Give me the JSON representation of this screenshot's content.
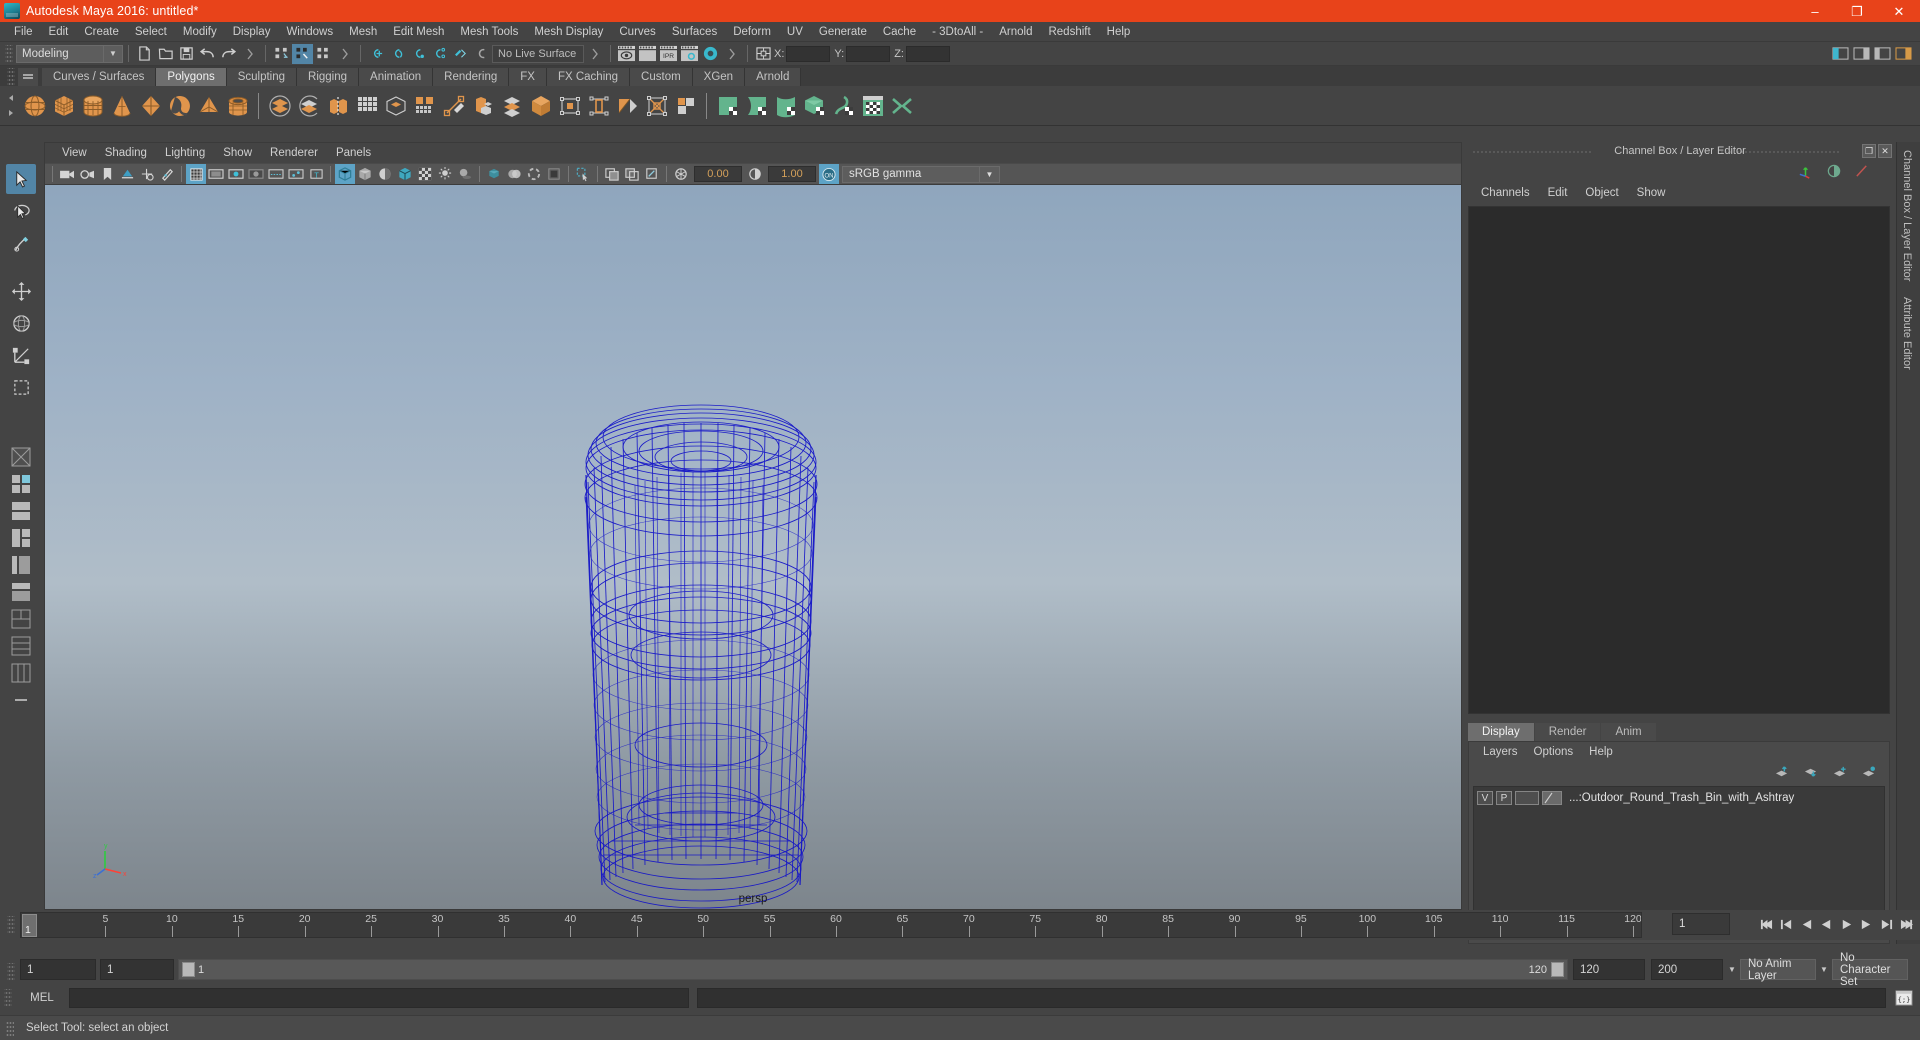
{
  "window": {
    "title": "Autodesk Maya 2016: untitled*",
    "app_icon": "maya-logo-icon",
    "minimize": "–",
    "maximize": "❐",
    "close": "✕",
    "titlebar_color": "#e8431a"
  },
  "menubar": {
    "items": [
      "File",
      "Edit",
      "Create",
      "Select",
      "Modify",
      "Display",
      "Windows",
      "Mesh",
      "Edit Mesh",
      "Mesh Tools",
      "Mesh Display",
      "Curves",
      "Surfaces",
      "Deform",
      "UV",
      "Generate",
      "Cache",
      "- 3DtoAll -",
      "Arnold",
      "Redshift",
      "Help"
    ]
  },
  "statusline": {
    "menu_set": "Modeling",
    "live_surface": "No Live Surface",
    "coord_labels": [
      "X:",
      "Y:",
      "Z:"
    ],
    "coord_values": [
      "",
      "",
      ""
    ],
    "icons": [
      "new-scene-icon",
      "open-scene-icon",
      "save-scene-icon",
      "undo-icon",
      "redo-icon",
      "select-hierarchy-icon",
      "select-object-icon",
      "select-component-icon",
      "snap-to-grid-icon",
      "snap-to-curve-icon",
      "snap-to-point-icon",
      "snap-to-projected-center-icon",
      "snap-to-view-plane-icon",
      "make-live-icon",
      "render-view-icon",
      "render-sequence-icon",
      "ipr-render-icon",
      "render-settings-icon",
      "hypershade-icon",
      "input-output-connections-icon"
    ]
  },
  "shelf": {
    "tabs": [
      "Curves / Surfaces",
      "Polygons",
      "Sculpting",
      "Rigging",
      "Animation",
      "Rendering",
      "FX",
      "FX Caching",
      "Custom",
      "XGen",
      "Arnold"
    ],
    "active_tab": "Polygons",
    "icons": [
      "poly-sphere-icon",
      "poly-cube-icon",
      "poly-cylinder-icon",
      "poly-cone-icon",
      "poly-torus-icon",
      "poly-plane-icon",
      "poly-pyramid-icon",
      "poly-pipe-icon",
      "poly-boolean-union-icon",
      "poly-boolean-difference-icon",
      "poly-combine-icon",
      "poly-separate-icon",
      "poly-smooth-icon",
      "poly-extrude-icon",
      "poly-bevel-icon",
      "poly-bridge-icon",
      "poly-append-icon",
      "poly-wedge-icon",
      "poly-duplicate-face-icon",
      "poly-connect-icon",
      "poly-merge-icon",
      "poly-multicut-icon",
      "poly-target-weld-icon",
      "poly-quad-draw-icon",
      "uv-editor-icon",
      "uv-planar-icon",
      "uv-cylindrical-icon",
      "uv-automatic-icon",
      "uv-unfold-icon",
      "uv-layout-icon",
      "uv-cut-sew-icon"
    ]
  },
  "toolbox": {
    "tools": [
      {
        "name": "select-tool",
        "selected": true
      },
      {
        "name": "lasso-select-tool",
        "selected": false
      },
      {
        "name": "paint-select-tool",
        "selected": false
      },
      {
        "name": "move-tool",
        "selected": false
      },
      {
        "name": "rotate-tool",
        "selected": false
      },
      {
        "name": "scale-tool",
        "selected": false
      },
      {
        "name": "last-tool-used",
        "selected": false
      }
    ],
    "layouts": [
      "single-perspective-layout",
      "four-view-layout",
      "two-panes-stacked-layout",
      "three-panes-split-layout",
      "outliner-persp-layout",
      "hypershade-persp-layout",
      "persp-graph-layout",
      "four-view-alt-layout",
      "outliner-graph-layout",
      "layout-more"
    ]
  },
  "viewport_panel": {
    "menus": [
      "View",
      "Shading",
      "Lighting",
      "Show",
      "Renderer",
      "Panels"
    ],
    "toolbar_icons": [
      "camera-select-icon",
      "camera-attributes-icon",
      "bookmark-icon",
      "image-plane-icon",
      "two-d-pan-zoom-icon",
      "grease-pencil-icon",
      "grid-toggle-icon",
      "film-gate-icon",
      "resolution-gate-icon",
      "gate-mask-icon",
      "film-origin-icon",
      "xray-joints-icon",
      "text-display-icon",
      "wireframe-shading-icon",
      "smooth-shade-all-icon",
      "shade-options-icon",
      "wireframe-on-shaded-icon",
      "textured-icon",
      "lighting-icon",
      "shadows-icon",
      "screen-space-ao-icon",
      "motion-blur-icon",
      "multisample-icon",
      "isolate-select-icon",
      "select-set-icon",
      "xray-icon",
      "xray-components-icon",
      "exposure-icon",
      "gamma-icon",
      "color-management-toggle-icon"
    ],
    "exposure_value": "0.00",
    "gamma_value": "1.00",
    "color_transform": "sRGB gamma",
    "camera_label": "persp",
    "object_wireframe_color": "#1414c8",
    "bg_top_color": "#8fa6bd",
    "bg_bottom_color": "#7d858c"
  },
  "right_dock": {
    "title": "Channel Box / Layer Editor",
    "undock_btn": "❐",
    "close_btn": "✕",
    "channelbox": {
      "menus": [
        "Channels",
        "Edit",
        "Object",
        "Show"
      ],
      "icons": [
        "channel-box-icon",
        "attribute-editor-icon",
        "tool-settings-icon"
      ]
    },
    "layer_editor": {
      "tabs": [
        "Display",
        "Render",
        "Anim"
      ],
      "active_tab": "Display",
      "menus": [
        "Layers",
        "Options",
        "Help"
      ],
      "buttons": [
        "move-layer-up-icon",
        "move-layer-down-icon",
        "new-layer-icon",
        "new-layer-from-selected-icon"
      ],
      "layers": [
        {
          "visibility": "V",
          "playback": "P",
          "shading": "",
          "name": "...:Outdoor_Round_Trash_Bin_with_Ashtray"
        }
      ]
    },
    "side_tabs": [
      "Channel Box / Layer Editor",
      "Attribute Editor"
    ]
  },
  "time_slider": {
    "ticks": [
      5,
      10,
      15,
      20,
      25,
      30,
      35,
      40,
      45,
      50,
      55,
      60,
      65,
      70,
      75,
      80,
      85,
      90,
      95,
      100,
      105,
      110,
      115,
      120
    ],
    "current_frame_marker": "1",
    "current_frame_field": "1",
    "transport_icons": [
      "go-to-start-icon",
      "step-back-keyframe-icon",
      "step-back-frame-icon",
      "play-backwards-icon",
      "play-forwards-icon",
      "step-forward-frame-icon",
      "step-forward-keyframe-icon",
      "go-to-end-icon"
    ]
  },
  "range_slider": {
    "start_field": "1",
    "playback_start_field": "1",
    "bar_start_label": "1",
    "bar_end_label": "120",
    "playback_end_field": "120",
    "end_field": "200",
    "anim_layer": "No Anim Layer",
    "character_set": "No Character Set",
    "icons": [
      "auto-key-icon",
      "animation-preferences-icon"
    ]
  },
  "command_line": {
    "label": "MEL",
    "input_value": "",
    "output_value": "",
    "script_editor_icon": "script-editor-icon"
  },
  "help_line": {
    "text": "Select Tool: select an object"
  }
}
